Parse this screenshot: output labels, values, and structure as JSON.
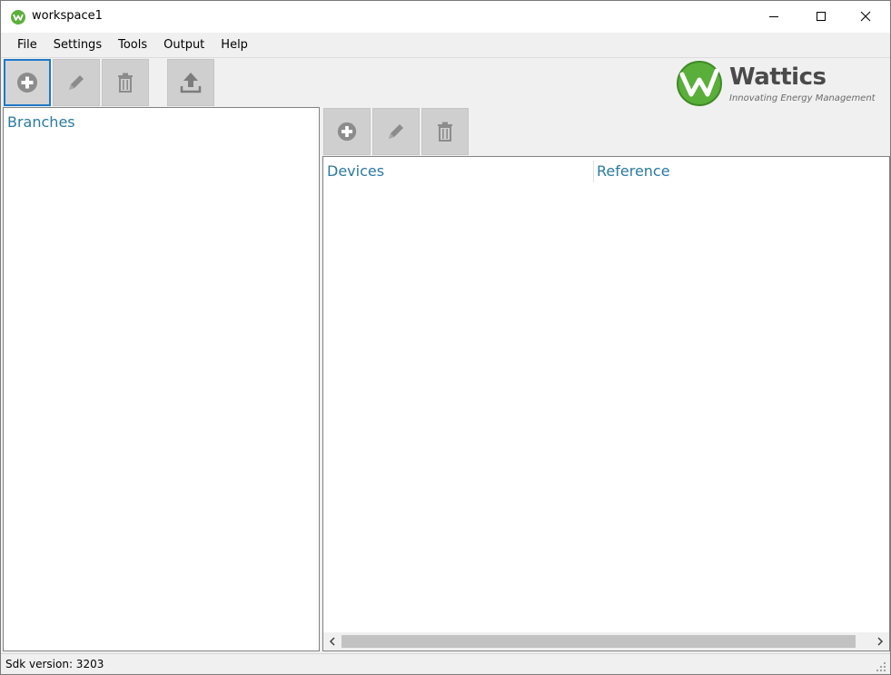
{
  "window": {
    "title": "workspace1",
    "controls": {
      "minimize_icon": "minimize-icon",
      "maximize_icon": "maximize-icon",
      "close_icon": "close-icon"
    }
  },
  "menu": {
    "items": [
      "File",
      "Settings",
      "Tools",
      "Output",
      "Help"
    ]
  },
  "toolbar": {
    "buttons": [
      {
        "icon": "add-icon",
        "state": "selected"
      },
      {
        "icon": "edit-icon",
        "state": "disabled"
      },
      {
        "icon": "delete-icon",
        "state": "disabled"
      },
      {
        "icon": "upload-icon",
        "state": "disabled"
      }
    ]
  },
  "logo": {
    "name": "Wattics",
    "tagline": "Innovating Energy Management"
  },
  "branches": {
    "heading": "Branches"
  },
  "devices_panel": {
    "toolbar": [
      {
        "icon": "add-icon",
        "state": "disabled"
      },
      {
        "icon": "edit-icon",
        "state": "disabled"
      },
      {
        "icon": "delete-icon",
        "state": "disabled"
      }
    ],
    "columns": [
      "Devices",
      "Reference"
    ],
    "rows": []
  },
  "status": {
    "text": "Sdk version: 3203"
  },
  "colors": {
    "accent": "#2c7aa0",
    "selection": "#1e78c8",
    "logo_green": "#5aae3a"
  }
}
